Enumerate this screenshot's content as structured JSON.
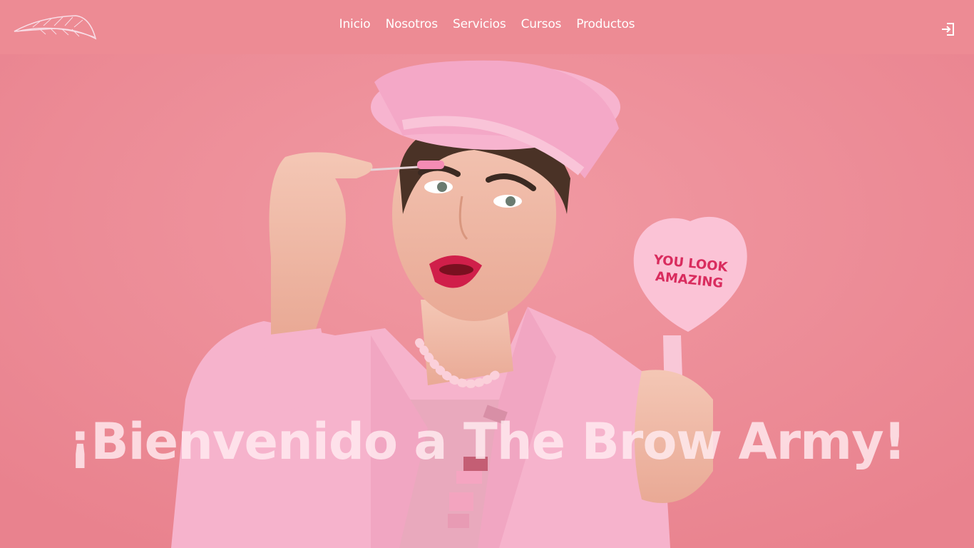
{
  "nav": {
    "logo_icon": "feather-logo-icon",
    "links": [
      "Inicio",
      "Nosotros",
      "Servicios",
      "Cursos",
      "Productos"
    ],
    "login_icon": "sign-in-icon"
  },
  "hero": {
    "title": "¡Bienvenido a The Brow Army!",
    "mirror_text_line1": "YOU LOOK",
    "mirror_text_line2": "AMAZING"
  },
  "colors": {
    "nav_bg": "#ed8b94",
    "hero_bg": "#ee8a95",
    "jacket_pink": "#f6b3cc",
    "lip_red": "#d01f4a"
  }
}
